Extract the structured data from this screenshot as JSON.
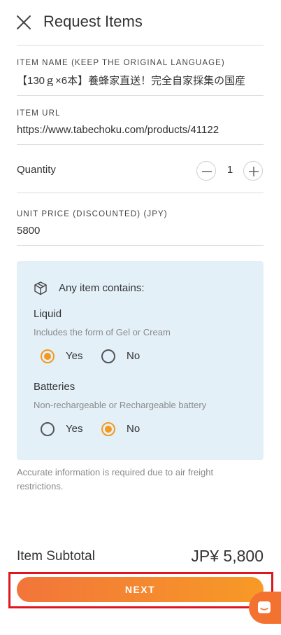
{
  "header": {
    "title": "Request Items",
    "close_icon": "close-icon"
  },
  "item_name": {
    "label": "ITEM NAME (KEEP THE ORIGINAL LANGUAGE)",
    "value": "【130ｇ×6本】養蜂家直送！完全自家採集の国産"
  },
  "item_url": {
    "label": "ITEM URL",
    "value": "https://www.tabechoku.com/products/41122"
  },
  "quantity": {
    "label": "Quantity",
    "value": "1",
    "minus_icon": "minus-icon",
    "plus_icon": "plus-icon"
  },
  "unit_price": {
    "label": "UNIT PRICE (DISCOUNTED) (JPY)",
    "value": "5800"
  },
  "contains": {
    "title": "Any item contains:",
    "icon": "package-icon",
    "liquid": {
      "title": "Liquid",
      "desc": "Includes the form of Gel or Cream",
      "yes": "Yes",
      "no": "No",
      "selected": "Yes"
    },
    "batteries": {
      "title": "Batteries",
      "desc": "Non-rechargeable or Rechargeable battery",
      "yes": "Yes",
      "no": "No",
      "selected": "No"
    }
  },
  "note": "Accurate information is required due to air freight restrictions.",
  "subtotal": {
    "label": "Item Subtotal",
    "value": "JP¥ 5,800"
  },
  "next_button": "NEXT",
  "chat_icon": "chat-icon",
  "colors": {
    "accent": "#f39a1e",
    "button_start": "#f2753a",
    "button_end": "#f79a26",
    "info_bg": "#e3f0f8",
    "highlight": "#e0161e"
  }
}
